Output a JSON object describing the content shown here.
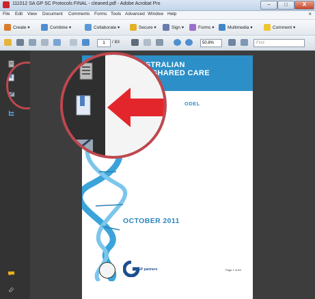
{
  "window": {
    "title": "111012 SA GP SC Protocols FINAL - cleaned.pdf - Adobe Acrobat Pro",
    "controls": {
      "minimize": "–",
      "maximize": "□",
      "close": "X"
    }
  },
  "menu": {
    "items": [
      "File",
      "Edit",
      "View",
      "Document",
      "Comments",
      "Forms",
      "Tools",
      "Advanced",
      "Window",
      "Help"
    ],
    "close": "×"
  },
  "tasks": {
    "create": "Create",
    "combine": "Combine",
    "collaborate": "Collaborate",
    "secure": "Secure",
    "sign": "Sign",
    "forms": "Forms",
    "multimedia": "Multimedia",
    "comment": "Comment"
  },
  "nav": {
    "page_current": "1",
    "page_total": "/ 83",
    "zoom": "50.8%",
    "find_placeholder": "Find"
  },
  "document": {
    "banner_line1": "TH AUSTRALIAN",
    "banner_line2": "TETRIC SHARED CARE",
    "banner_line3": "OLS",
    "subtitle": "ODEL",
    "date": "OCTOBER 2011",
    "partner_name": "GP partners",
    "page_label": "Page 1 of 83"
  },
  "colors": {
    "banner": "#2c8fc7",
    "callout": "#c0474e",
    "arrow": "#e3262b",
    "panel_bg": "#333333"
  }
}
